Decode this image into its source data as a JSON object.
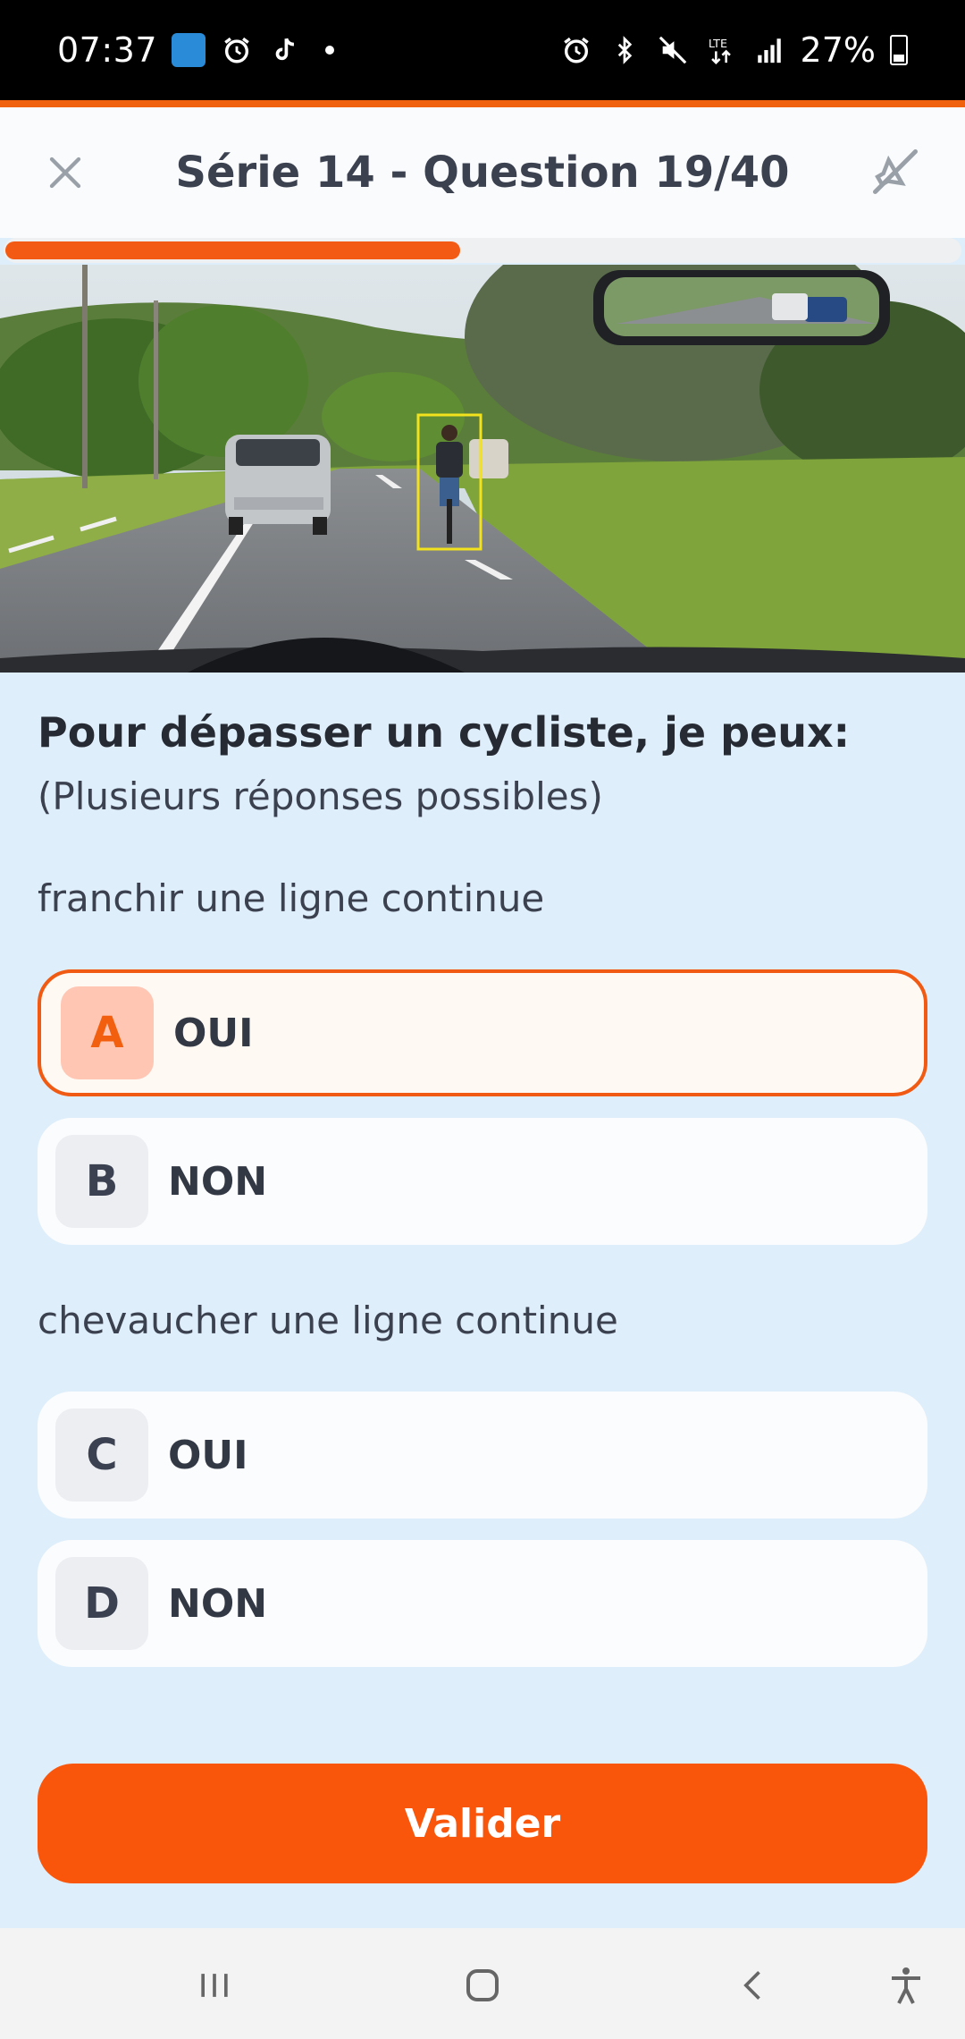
{
  "status_bar": {
    "time": "07:37",
    "battery": "27%",
    "left_icons": [
      "app-notification-icon",
      "alarm-icon",
      "tiktok-icon",
      "dot-icon"
    ],
    "right_icons": [
      "alarm-icon",
      "bluetooth-icon",
      "mute-icon",
      "lte-icon",
      "signal-icon",
      "battery-icon"
    ]
  },
  "header": {
    "title": "Série 14 - Question 19/40",
    "close_icon": "close-icon",
    "sound_icon": "sound-off-icon"
  },
  "progress": {
    "fraction": 0.475
  },
  "question": {
    "text": "Pour dépasser un cycliste, je peux:",
    "hint": "(Plusieurs réponses possibles)"
  },
  "groups": [
    {
      "label": "franchir une ligne continue",
      "options": [
        {
          "letter": "A",
          "text": "OUI",
          "selected": true
        },
        {
          "letter": "B",
          "text": "NON",
          "selected": false
        }
      ]
    },
    {
      "label": "chevaucher une ligne continue",
      "options": [
        {
          "letter": "C",
          "text": "OUI",
          "selected": false
        },
        {
          "letter": "D",
          "text": "NON",
          "selected": false
        }
      ]
    }
  ],
  "submit_label": "Valider",
  "colors": {
    "accent": "#f9560c",
    "background": "#dfeefb",
    "selected_letter_bg": "#ffc6b4"
  },
  "navbar": {
    "icons": [
      "recent-apps-icon",
      "home-icon",
      "back-icon",
      "accessibility-icon"
    ]
  }
}
